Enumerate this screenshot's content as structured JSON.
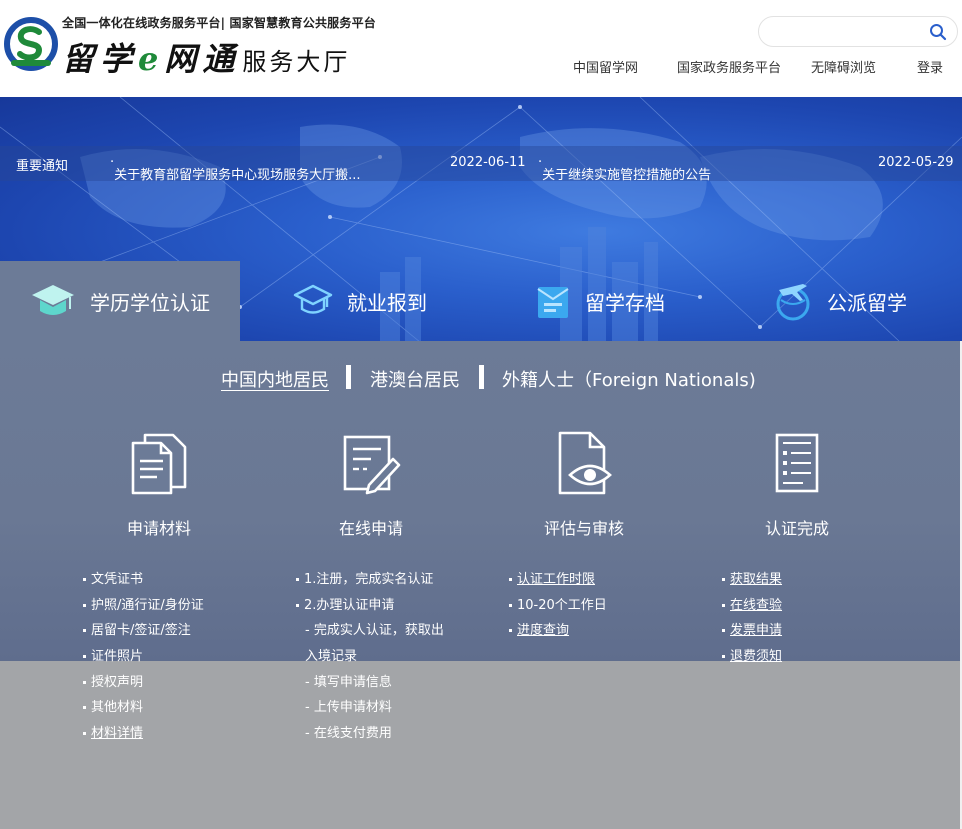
{
  "header": {
    "subtitle": "全国一体化在线政务服务平台| 国家智慧教育公共服务平台",
    "brand_a": "留学",
    "brand_e": "e",
    "brand_b": "网通",
    "brand_suffix": "服务大厅",
    "search_placeholder": "",
    "nav": [
      "中国留学网",
      "国家政务服务平台",
      "无障碍浏览",
      "登录"
    ]
  },
  "notice": {
    "label": "重要通知",
    "items": [
      {
        "title": "关于教育部留学服务中心现场服务大厅搬...",
        "date": "2022-06-11"
      },
      {
        "title": "关于继续实施管控措施的公告",
        "date": "2022-05-29"
      }
    ]
  },
  "tabs": [
    {
      "label": "学历学位认证",
      "icon": "graduation-cap-icon",
      "active": true
    },
    {
      "label": "就业报到",
      "icon": "mortarboard-icon",
      "active": false
    },
    {
      "label": "留学存档",
      "icon": "archive-icon",
      "active": false
    },
    {
      "label": "公派留学",
      "icon": "globe-plane-icon",
      "active": false
    }
  ],
  "residency": [
    "中国内地居民",
    "港澳台居民",
    "外籍人士（Foreign Nationals)"
  ],
  "steps": [
    {
      "title": "申请材料",
      "icon": "documents-icon"
    },
    {
      "title": "在线申请",
      "icon": "form-edit-icon"
    },
    {
      "title": "评估与审核",
      "icon": "document-eye-icon"
    },
    {
      "title": "认证完成",
      "icon": "checklist-icon"
    }
  ],
  "lists": {
    "materials": [
      "文凭证书",
      "护照/通行证/身份证",
      "居留卡/签证/签注",
      "证件照片",
      "授权声明",
      "其他材料",
      "材料详情"
    ],
    "apply": [
      "1.注册，完成实名认证",
      "2.办理认证申请",
      "- 完成实人认证，获取出",
      "入境记录",
      "- 填写申请信息",
      "- 上传申请材料",
      "- 在线支付费用"
    ],
    "review": [
      "认证工作时限",
      "10-20个工作日",
      "进度查询"
    ],
    "complete": [
      "获取结果",
      "在线查验",
      "发票申请",
      "退费须知"
    ]
  },
  "colors": {
    "banner_blue": "#2a5fcc",
    "panel_slate": "#6c7b97",
    "panel_grey": "#a3a5a8",
    "logo_blue": "#1d4fa8",
    "logo_green": "#1f8a3a"
  }
}
